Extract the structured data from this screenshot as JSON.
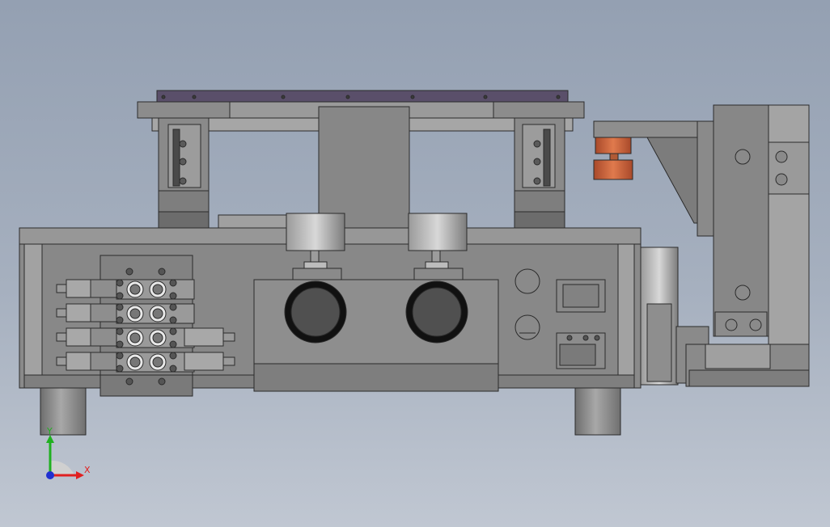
{
  "viewport": {
    "background_top": "#94a0b2",
    "background_bottom": "#c0c7d2",
    "part_fill": "#8c8c8c",
    "dark_plate": "#7e7e7e",
    "edge": "#2b2b2b",
    "accent_orange": "#c9643c",
    "top_plate_purple": "#5a4f6a"
  },
  "triad": {
    "x_label": "X",
    "y_label": "Y",
    "x_color": "#e02020",
    "y_color": "#20b020",
    "z_color": "#2030d0",
    "icon": "coordinate-triad-icon"
  }
}
